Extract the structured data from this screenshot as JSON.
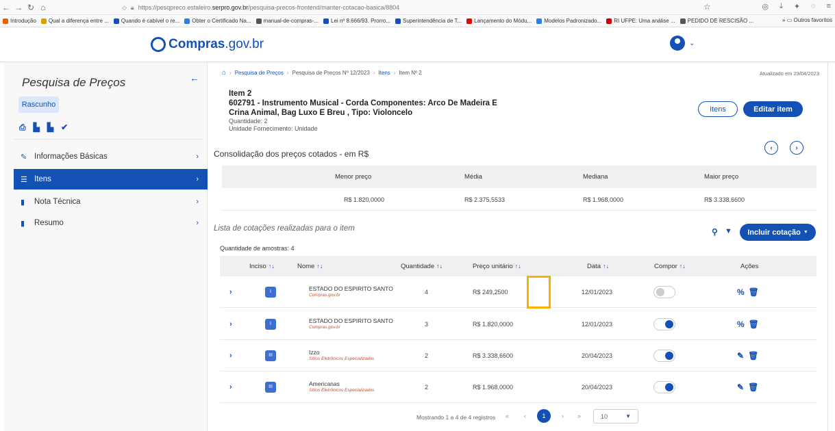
{
  "browser": {
    "url_prefix": "https://pesqpreco.estaleiro.",
    "url_domain": "serpro.gov.br",
    "url_path": "/pesquisa-precos-frontend/manter-cotacao-basica/8804",
    "bookmarks": [
      "Introdução",
      "Qual a diferença entre ...",
      "Quando é cabível o re...",
      "Obter o Certificado Na...",
      "manual-de-compras-...",
      "Lei nº 8.666/93. Prorro...",
      "Superintendência de T...",
      "Lançamento do Módu...",
      "Modelos Padronizado...",
      "RI UFPE: Uma análise ...",
      "PEDIDO DE RESCISÃO ..."
    ],
    "other_bookmarks": "Outros favoritos"
  },
  "header": {
    "logo_main": "Compras",
    "logo_suffix": ".gov.br"
  },
  "sidebar": {
    "title": "Pesquisa de Preços",
    "status": "Rascunho",
    "items": [
      {
        "label": "Informações Básicas",
        "icon": "pencil-icon"
      },
      {
        "label": "Itens",
        "icon": "list-icon"
      },
      {
        "label": "Nota Técnica",
        "icon": "file-icon"
      },
      {
        "label": "Resumo",
        "icon": "file-icon"
      }
    ]
  },
  "breadcrumb": {
    "items": [
      "Pesquisa de Preços",
      "Pesquisa de Preços Nº 12/2023",
      "Itens",
      "Item Nº 2"
    ],
    "updated": "Atualizado em 23/04/2023"
  },
  "item": {
    "number": "Item 2",
    "description": "602791 - Instrumento Musical - Corda Componentes: Arco De Madeira E Crina Animal, Bag Luxo E Breu , Tipo: Violoncelo",
    "quantity": "Quantidade: 2",
    "unit": "Unidade Fornecimento: Unidade",
    "btn_items": "Itens",
    "btn_edit": "Editar item"
  },
  "consolidation": {
    "title": "Consolidação dos preços cotados - em R$",
    "headers": [
      "Menor preço",
      "Média",
      "Mediana",
      "Maior preço"
    ],
    "values": [
      "R$ 1.820,0000",
      "R$ 2.375,5533",
      "R$ 1.968,0000",
      "R$ 3.338,6600"
    ]
  },
  "quotes": {
    "title": "Lista de cotações realizadas para o item",
    "add_button": "Incluir cotação",
    "sample_count": "Quantidade de amostras: 4",
    "headers": {
      "inciso": "Inciso",
      "nome": "Nome",
      "quantidade": "Quantidade",
      "preco": "Preço unitário",
      "data": "Data",
      "compor": "Compor",
      "acoes": "Ações"
    },
    "rows": [
      {
        "inciso": "I",
        "nome": "ESTADO DO ESPIRITO SANTO",
        "fonte": "Compras.gov.br",
        "quantidade": "4",
        "preco": "R$ 249,2500",
        "data": "12/01/2023",
        "compor": false,
        "action": "percent-icon"
      },
      {
        "inciso": "I",
        "nome": "ESTADO DO ESPIRITO SANTO",
        "fonte": "Compras.gov.br",
        "quantidade": "3",
        "preco": "R$ 1.820,0000",
        "data": "12/01/2023",
        "compor": true,
        "action": "percent-icon"
      },
      {
        "inciso": "III",
        "nome": "Izzo",
        "fonte": "Sítios Eletrônicos Especializados",
        "quantidade": "2",
        "preco": "R$ 3.338,6600",
        "data": "20/04/2023",
        "compor": true,
        "action": "edit-icon"
      },
      {
        "inciso": "III",
        "nome": "Americanas",
        "fonte": "Sítios Eletrônicos Especializados",
        "quantidade": "2",
        "preco": "R$ 1.968,0000",
        "data": "20/04/2023",
        "compor": true,
        "action": "edit-icon"
      }
    ]
  },
  "pagination": {
    "info": "Mostrando 1 a 4 de 4 registros",
    "current_page": "1",
    "page_size": "10"
  }
}
